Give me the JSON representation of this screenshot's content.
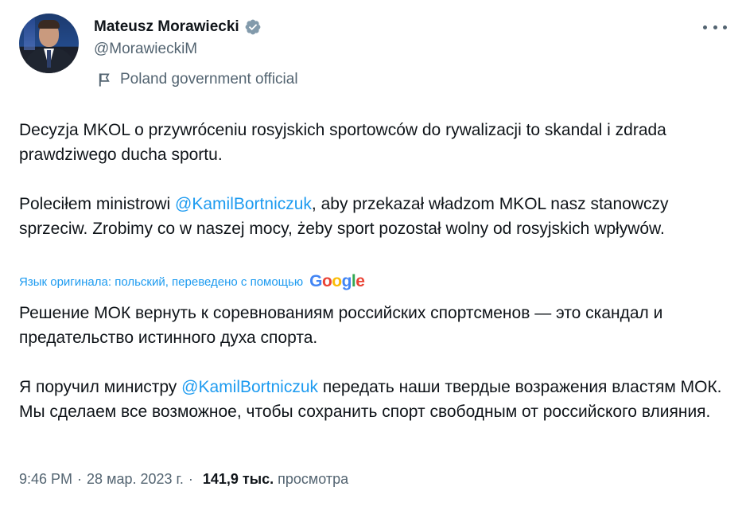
{
  "author": {
    "name": "Mateusz Morawiecki",
    "handle": "@MorawieckiM",
    "label": "Poland government official",
    "verified_color": "#829aab"
  },
  "tweet": {
    "original_p1": "Decyzja MKOL o przywróceniu rosyjskich sportowców do rywalizacji to skandal i zdrada prawdziwego ducha sportu.",
    "original_p2_before": "Poleciłem ministrowi ",
    "mention": "@KamilBortniczuk",
    "original_p2_after": ", aby przekazał władzom MKOL nasz stanowczy sprzeciw. Zrobimy co w naszej mocy, żeby sport pozostał wolny od rosyjskich wpływów.",
    "translation_note": "Язык оригинала: польский, переведено с помощью",
    "translation_provider": "Google",
    "translated_p1": "Решение МОК вернуть к соревнованиям российских спортсменов — это скандал и предательство истинного духа спорта.",
    "translated_p2_before": "Я поручил министру ",
    "translated_p2_after": " передать наши твердые возражения властям МОК. Мы сделаем все возможное, чтобы сохранить спорт свободным от российского влияния."
  },
  "meta": {
    "time": "9:46 PM",
    "date": "28 мар. 2023 г.",
    "views_count": "141,9 тыс.",
    "views_label": "просмотра"
  },
  "colors": {
    "accent": "#1d9bf0",
    "secondary_text": "#536471",
    "primary_text": "#0f1419"
  }
}
